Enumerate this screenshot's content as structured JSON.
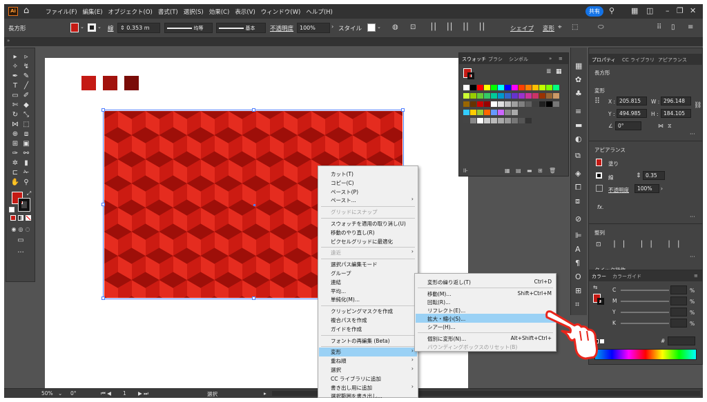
{
  "menubar": {
    "logo": "Ai",
    "menus": [
      "ファイル(F)",
      "編集(E)",
      "オブジェクト(O)",
      "書式(T)",
      "選択(S)",
      "効果(C)",
      "表示(V)",
      "ウィンドウ(W)",
      "ヘルプ(H)"
    ],
    "share": "共有"
  },
  "control": {
    "object": "長方形",
    "stroke_label": "線",
    "stroke_value": "0.353 m",
    "profile": "均等",
    "brush": "基本",
    "opacity_label": "不透明度",
    "opacity_value": "100%",
    "style_label": "スタイル",
    "shape_label": "シェイプ",
    "transform_label": "変形"
  },
  "artboard": {
    "swatch_colors": [
      "#c41a14",
      "#a2120d",
      "#7a0c08"
    ]
  },
  "context_menu": {
    "items": [
      {
        "label": "カット(T)",
        "disabled": false,
        "sub": false
      },
      {
        "label": "コピー(C)",
        "disabled": false,
        "sub": false
      },
      {
        "label": "ペースト(P)",
        "disabled": false,
        "sub": false
      },
      {
        "label": "ペースト...",
        "disabled": false,
        "sub": true
      },
      {
        "label": "グリッドにスナップ",
        "disabled": true,
        "sub": false
      },
      {
        "label": "スウォッチを適用の取り消し(U)",
        "disabled": false,
        "sub": false
      },
      {
        "label": "移動のやり直し(R)",
        "disabled": false,
        "sub": false
      },
      {
        "label": "ピクセルグリッドに最適化",
        "disabled": false,
        "sub": false
      },
      {
        "label": "遠近",
        "disabled": true,
        "sub": true
      },
      {
        "label": "選択パス編集モード",
        "disabled": false,
        "sub": false
      },
      {
        "label": "グループ",
        "disabled": false,
        "sub": false
      },
      {
        "label": "連結",
        "disabled": false,
        "sub": false
      },
      {
        "label": "平均...",
        "disabled": false,
        "sub": false
      },
      {
        "label": "単純化(M)...",
        "disabled": false,
        "sub": false
      },
      {
        "label": "クリッピングマスクを作成",
        "disabled": false,
        "sub": false
      },
      {
        "label": "複合パスを作成",
        "disabled": false,
        "sub": false
      },
      {
        "label": "ガイドを作成",
        "disabled": false,
        "sub": false
      },
      {
        "label": "フォントの再編集 (Beta)",
        "disabled": false,
        "sub": false
      },
      {
        "label": "変形",
        "disabled": false,
        "sub": true,
        "highlight": true
      },
      {
        "label": "重ね順",
        "disabled": false,
        "sub": true
      },
      {
        "label": "選択",
        "disabled": false,
        "sub": true
      },
      {
        "label": "CC ライブラリに追加",
        "disabled": false,
        "sub": false
      },
      {
        "label": "書き出し用に追加",
        "disabled": false,
        "sub": true
      },
      {
        "label": "選択範囲を書き出し...",
        "disabled": false,
        "sub": false
      }
    ]
  },
  "submenu": {
    "items": [
      {
        "label": "変形の繰り返し(T)",
        "shortcut": "Ctrl+D"
      },
      {
        "label": "移動(M)...",
        "shortcut": "Shift+Ctrl+M"
      },
      {
        "label": "回転(R)...",
        "shortcut": ""
      },
      {
        "label": "リフレクト(E)...",
        "shortcut": ""
      },
      {
        "label": "拡大・縮小(S)...",
        "shortcut": "",
        "highlight": true
      },
      {
        "label": "シアー(H)...",
        "shortcut": ""
      },
      {
        "label": "個別に変形(N)...",
        "shortcut": "Alt+Shift+Ctrl+"
      },
      {
        "label": "バウンディングボックスのリセット(B)",
        "shortcut": "",
        "disabled": true
      }
    ]
  },
  "swatches": {
    "tabs": [
      "スウォッチ",
      "ブラシ",
      "シンボル"
    ]
  },
  "properties": {
    "tabs": [
      "プロパティ",
      "CC ライブラリ",
      "アピアランス"
    ],
    "object": "長方形",
    "transform_heading": "変形",
    "x": "205.815",
    "y": "494.985",
    "w": "296.148",
    "h": "184.105",
    "angle": "0°",
    "appearance_heading": "アピアランス",
    "fill_label": "塗り",
    "stroke_label": "線",
    "stroke_value": "0.35",
    "opacity_label": "不透明度",
    "opacity_value": "100%",
    "fx": "fx.",
    "align_heading": "整列",
    "quick_label": "クイック操作"
  },
  "color": {
    "tabs": [
      "カラー",
      "カラーガイド"
    ],
    "channels": [
      "C",
      "M",
      "Y",
      "K"
    ],
    "unit": "%"
  },
  "status": {
    "zoom": "50%",
    "angle": "0°",
    "page": "1",
    "tool": "選択"
  }
}
